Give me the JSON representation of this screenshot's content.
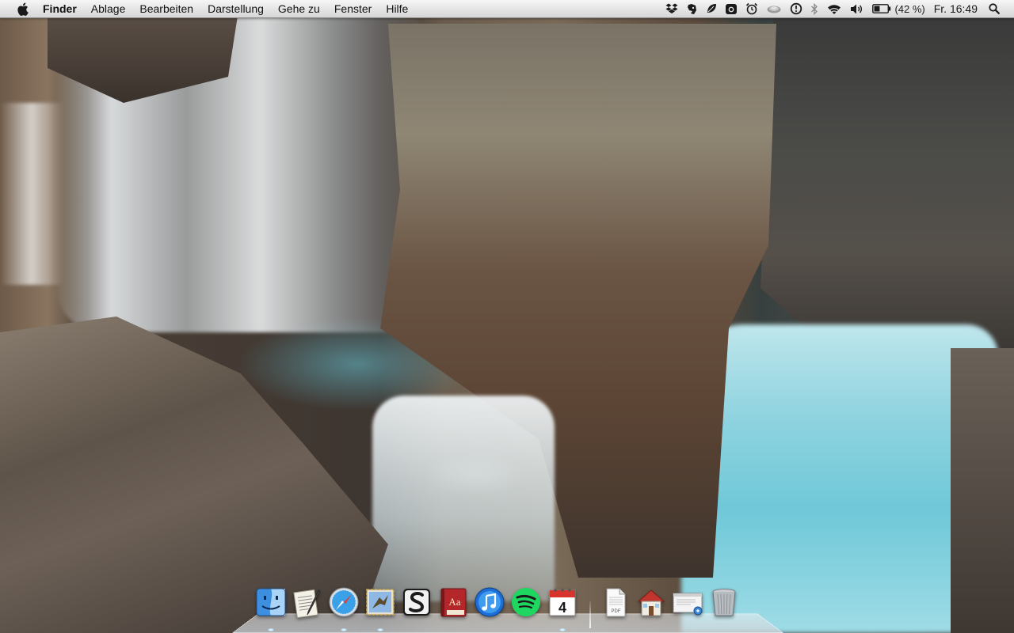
{
  "menubar": {
    "apple_icon": "apple-logo-icon",
    "app_name": "Finder",
    "menus": [
      "Ablage",
      "Bearbeiten",
      "Darstellung",
      "Gehe zu",
      "Fenster",
      "Hilfe"
    ],
    "status_icons": [
      "dropbox-icon",
      "evernote-icon",
      "leaf-icon",
      "camera-icon",
      "alarm-clock-icon",
      "cloud-icon",
      "time-machine-icon",
      "bluetooth-icon",
      "wifi-icon",
      "volume-icon",
      "battery-icon"
    ],
    "battery_percent": "(42 %)",
    "battery_level": 0.42,
    "clock": "Fr. 16:49",
    "spotlight_icon": "spotlight-search-icon"
  },
  "dock": {
    "apps": [
      {
        "icon": "finder-icon",
        "running": true
      },
      {
        "icon": "textedit-icon",
        "running": false
      },
      {
        "icon": "safari-icon",
        "running": true
      },
      {
        "icon": "mail-icon",
        "running": true
      },
      {
        "icon": "scrivener-icon",
        "running": false
      },
      {
        "icon": "dictionary-icon",
        "running": false
      },
      {
        "icon": "itunes-icon",
        "running": false
      },
      {
        "icon": "spotify-icon",
        "running": false
      },
      {
        "icon": "calendar-icon",
        "running": true,
        "badge_day": "4"
      }
    ],
    "docs": [
      {
        "icon": "pdf-document-icon"
      },
      {
        "icon": "home-folder-icon"
      },
      {
        "icon": "preview-window-icon"
      },
      {
        "icon": "trash-icon"
      }
    ],
    "pdf_label": "PDF"
  },
  "colors": {
    "menubar_text": "#111111",
    "spotify_green": "#1ed760",
    "itunes_blue": "#1d6fd6",
    "dictionary_red": "#b3262a"
  }
}
